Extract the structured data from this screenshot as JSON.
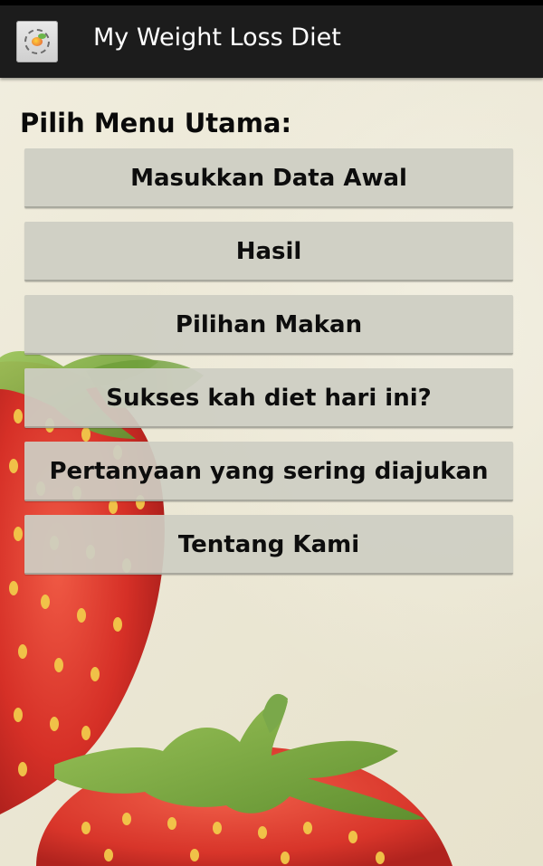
{
  "action_bar": {
    "app_icon": "app-logo-icon",
    "title": "My Weight Loss Diet",
    "background": "#1c1c1c"
  },
  "main": {
    "heading": "Pilih Menu Utama:",
    "menu_items": [
      {
        "label": "Masukkan Data Awal"
      },
      {
        "label": "Hasil"
      },
      {
        "label": "Pilihan Makan"
      },
      {
        "label": "Sukses kah diet hari ini?"
      },
      {
        "label": "Pertanyaan yang sering diajukan"
      },
      {
        "label": "Tentang Kami"
      }
    ]
  },
  "background_image": "strawberries-photo",
  "colors": {
    "background": "#ece8d6",
    "button": "#cecdc3",
    "strawberry_red": "#d9342b",
    "leaf_green": "#7fae45"
  }
}
